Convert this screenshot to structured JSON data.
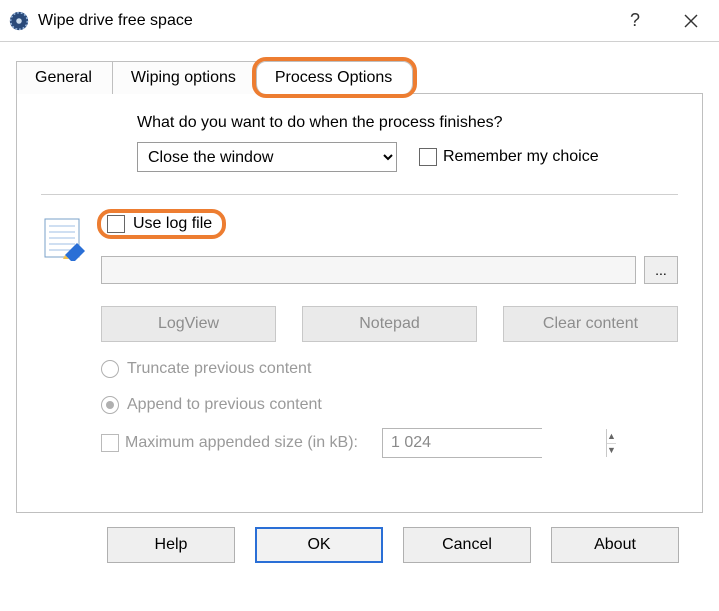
{
  "window": {
    "title": "Wipe drive free space"
  },
  "tabs": {
    "general": "General",
    "wiping": "Wiping options",
    "process": "Process Options"
  },
  "process": {
    "question": "What do you want to do when the process finishes?",
    "finish_selected": "Close the window",
    "remember_label": "Remember my choice"
  },
  "log": {
    "use_label": "Use log file",
    "path_value": "",
    "browse_label": "...",
    "btn_logview": "LogView",
    "btn_notepad": "Notepad",
    "btn_clear": "Clear content",
    "radio_truncate": "Truncate previous content",
    "radio_append": "Append to previous content",
    "max_size_label": "Maximum appended size (in kB):",
    "max_size_value": "1 024"
  },
  "footer": {
    "help": "Help",
    "ok": "OK",
    "cancel": "Cancel",
    "about": "About"
  }
}
